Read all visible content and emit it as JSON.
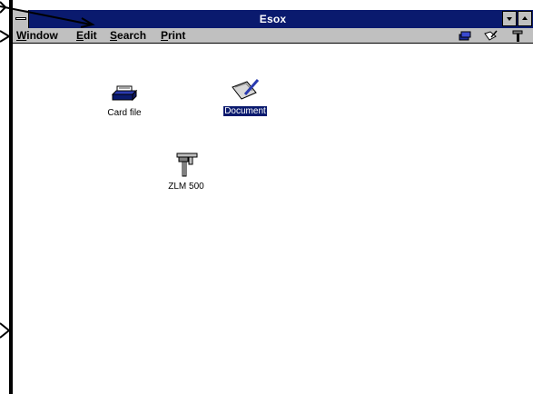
{
  "window": {
    "title": "Esox"
  },
  "menu": [
    {
      "key": "W",
      "rest": "indow"
    },
    {
      "key": "E",
      "rest": "dit"
    },
    {
      "key": "S",
      "rest": "earch"
    },
    {
      "key": "P",
      "rest": "rint"
    }
  ],
  "toolbar": {
    "icons": [
      "cards-icon",
      "edit-icon",
      "tools-icon"
    ]
  },
  "desktop": {
    "items": [
      {
        "label": "Card file",
        "icon": "card-file-icon",
        "selected": false
      },
      {
        "label": "Document",
        "icon": "document-icon",
        "selected": true
      },
      {
        "label": "ZLM 500",
        "icon": "caliper-icon",
        "selected": false
      }
    ]
  },
  "colors": {
    "title_bar": "#0a1a6e",
    "menu_bg": "#c0c0c0",
    "selection": "#0a1a6e"
  }
}
